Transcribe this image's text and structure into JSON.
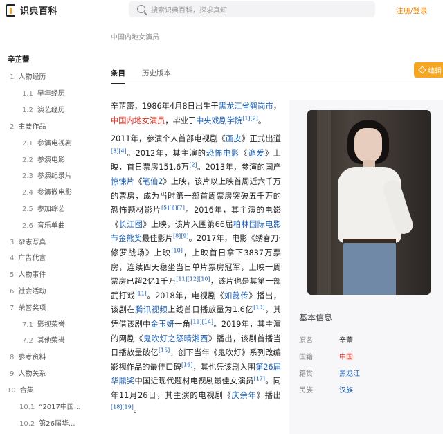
{
  "header": {
    "logo_text": "识典百科",
    "search_placeholder": "搜索识典百科，探求真知",
    "login_label": "注册/登录"
  },
  "toc": {
    "title": "辛芷蕾",
    "items": [
      {
        "num": "1",
        "label": "人物经历"
      },
      {
        "num": "1.1",
        "label": "早年经历"
      },
      {
        "num": "1.2",
        "label": "演艺经历"
      },
      {
        "num": "2",
        "label": "主要作品"
      },
      {
        "num": "2.1",
        "label": "参演电视剧"
      },
      {
        "num": "2.2",
        "label": "参演电影"
      },
      {
        "num": "2.3",
        "label": "参演纪录片"
      },
      {
        "num": "2.4",
        "label": "参演微电影"
      },
      {
        "num": "2.5",
        "label": "参加综艺"
      },
      {
        "num": "2.6",
        "label": "音乐单曲"
      },
      {
        "num": "3",
        "label": "杂志写真"
      },
      {
        "num": "4",
        "label": "广告代言"
      },
      {
        "num": "5",
        "label": "人物事件"
      },
      {
        "num": "6",
        "label": "社会活动"
      },
      {
        "num": "7",
        "label": "荣誉奖项"
      },
      {
        "num": "7.1",
        "label": "影视荣誉"
      },
      {
        "num": "7.2",
        "label": "其他荣誉"
      },
      {
        "num": "8",
        "label": "参考资料"
      },
      {
        "num": "9",
        "label": "人物关系"
      },
      {
        "num": "10",
        "label": "合集"
      },
      {
        "num": "10.1",
        "label": "“2017中国..."
      },
      {
        "num": "10.2",
        "label": "第26届华..."
      }
    ]
  },
  "page": {
    "category": "中国内地女演员",
    "tab_entry": "条目",
    "tab_history": "历史版本",
    "edit_label": "编辑"
  },
  "article": {
    "p1": [
      "辛芷蕾，1986年4月8日出生于",
      "黑龙江省鹤岗市",
      "，",
      "中国内地女演员",
      "，毕业于",
      "中央戏剧学院",
      "[1][2]",
      "。"
    ],
    "p2": [
      "2011年，参演个人首部电视剧《",
      "画皮",
      "》正式出道",
      "[3][4]",
      "。2012年，其主演的",
      "恐怖电影",
      "《",
      "诡爱",
      "》上映，首日票房151.6万",
      "[2]",
      "。2013年，参演的国产",
      "惊悚片",
      "《",
      "笔仙2",
      "》上映，该片以上映首周近六千万的票房，成为当时第一部首周票房突破五千万的恐怖题材影片",
      "[5][6][7]",
      "。2016年，其主演的电影《",
      "长江图",
      "》上映，该片入围第66届",
      "柏林国际电影节金熊奖",
      "最佳影片",
      "[8][9]",
      "。2017年，电影《绣春刀·修罗战场》上映",
      "[10]",
      "，上映首日拿下3837万票房，连续四天稳坐当日单片票房冠军，上映一周票房已超2亿1千万",
      "[11][12][10]",
      "，该片也是其第一部武打戏",
      "[11]",
      "。2018年，电视剧《",
      "如懿传",
      "》播出，该剧在",
      "腾讯视频",
      "上线首日播放量为1.6亿",
      "[13]",
      "，其凭借该剧中",
      "金玉妍",
      "一角",
      "[11][14]",
      "。2019年，其主演的网剧《",
      "鬼吹灯之怒晴湘西",
      "》播出，该剧首播当日播放量破亿",
      "[15]",
      "，创下当年《鬼吹灯》系列改编影视作品的最佳口碑",
      "[16]",
      "，其也凭该剧入围",
      "第26届华鼎奖",
      "中国近现代题材电视剧最佳女演员",
      "[17]",
      "。同年11月26日，其主演的电视剧《",
      "庆余年",
      "》播出",
      "[18][19]",
      "。"
    ]
  },
  "infobox": {
    "title": "基本信息",
    "rows": [
      {
        "k": "原名",
        "v": "辛蕾"
      },
      {
        "k": "国籍",
        "v": "中国"
      },
      {
        "k": "籍贯",
        "v": "黑龙江"
      },
      {
        "k": "民族",
        "v": "汉族"
      }
    ]
  }
}
